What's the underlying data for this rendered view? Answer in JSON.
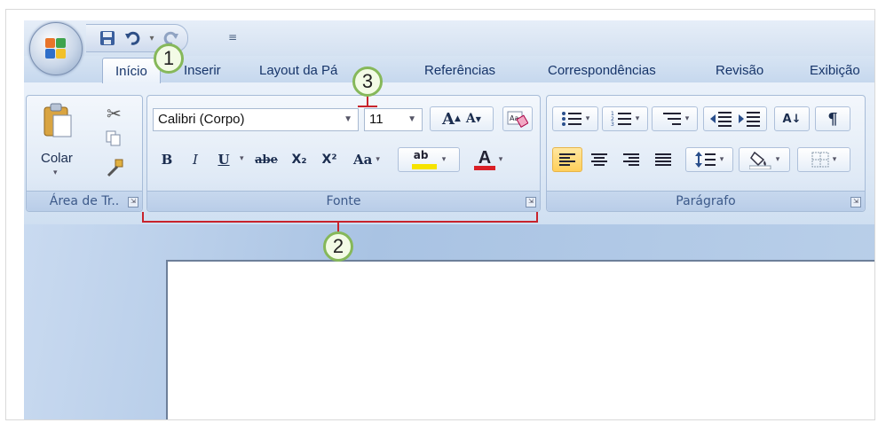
{
  "qat": {
    "save_icon": "save-icon",
    "undo_icon": "undo-icon",
    "redo_icon": "redo-icon",
    "more": "≡"
  },
  "tabs": [
    {
      "label": "Início",
      "active": true
    },
    {
      "label": "Inserir"
    },
    {
      "label": "Layout da Pá"
    },
    {
      "label": "Referências"
    },
    {
      "label": "Correspondências"
    },
    {
      "label": "Revisão"
    },
    {
      "label": "Exibição"
    }
  ],
  "clipboard": {
    "paste_label": "Colar",
    "group_label": "Área de Tr..",
    "launcher": "⇲"
  },
  "font": {
    "family": "Calibri (Corpo)",
    "size": "11",
    "grow": "A",
    "shrink": "A",
    "clear": "A̶a",
    "bold": "B",
    "italic": "I",
    "underline": "U",
    "strike": "abe",
    "subscript": "X₂",
    "superscript": "X²",
    "case": "Aa",
    "highlight": "ab",
    "color": "A",
    "group_label": "Fonte",
    "launcher": "⇲"
  },
  "paragraph": {
    "group_label": "Parágrafo",
    "launcher": "⇲",
    "sort": "A↓",
    "pilcrow": "¶"
  },
  "callouts": {
    "c1": "1",
    "c2": "2",
    "c3": "3"
  },
  "colors": {
    "accent_red": "#c8232c",
    "callout_green": "#86b85a",
    "highlight_yellow": "#f6e300",
    "font_red": "#d91f26"
  }
}
